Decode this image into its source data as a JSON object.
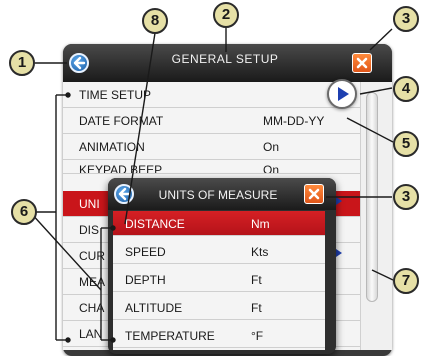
{
  "main_window": {
    "title": "GENERAL SETUP",
    "rows": [
      {
        "label": "TIME SETUP",
        "value": ""
      },
      {
        "label": "DATE FORMAT",
        "value": "MM-DD-YY"
      },
      {
        "label": "ANIMATION",
        "value": "On"
      },
      {
        "label": "KEYPAD BEEP",
        "value": "On"
      },
      {
        "label": "UNI",
        "value": ""
      },
      {
        "label": "DIS",
        "value": ""
      },
      {
        "label": "CUR",
        "value": ""
      },
      {
        "label": "MEA",
        "value": ""
      },
      {
        "label": "CHA",
        "value": ""
      },
      {
        "label": "LAN",
        "value": ""
      }
    ]
  },
  "popup": {
    "title": "UNITS OF MEASURE",
    "rows": [
      {
        "label": "DISTANCE",
        "value": "Nm"
      },
      {
        "label": "SPEED",
        "value": "Kts"
      },
      {
        "label": "DEPTH",
        "value": "Ft"
      },
      {
        "label": "ALTITUDE",
        "value": "Ft"
      },
      {
        "label": "TEMPERATURE",
        "value": "°F"
      }
    ]
  },
  "callouts": [
    "1",
    "2",
    "3",
    "4",
    "5",
    "6",
    "7",
    "8",
    "3"
  ],
  "icons": {
    "back": "back-arrow-icon",
    "close": "close-x-icon",
    "next": "play-triangle-icon",
    "submenu": "submenu-triangle-icon"
  },
  "colors": {
    "selected_row": "#c9151a",
    "titlebar": "#2a2a2a",
    "callout_fill": "#e6e0a6",
    "accent_blue": "#1d5fa6",
    "close_orange": "#f07020"
  }
}
